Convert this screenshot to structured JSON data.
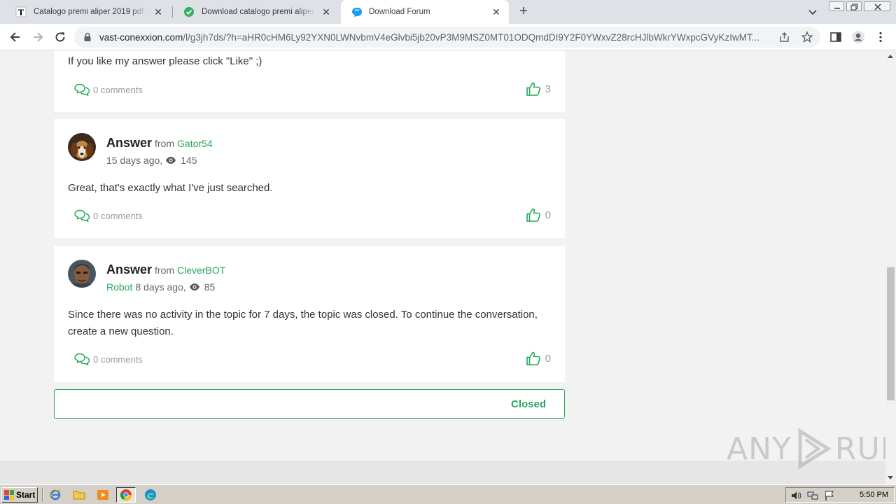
{
  "browser": {
    "tabs": [
      {
        "title": "Catalogo premi aliper 2019 pdf – Tele",
        "icon": "telegraph-t-icon"
      },
      {
        "title": "Download catalogo premi aliper 2019",
        "icon": "green-check-icon"
      },
      {
        "title": "Download Forum",
        "icon": "forum-chat-icon",
        "active": true
      }
    ],
    "url_host": "vast-conexxion.com",
    "url_path": "/l/g3jh7ds/?h=aHR0cHM6Ly92YXN0LWNvbmV4eGlvbi5jb20vP3M9MSZ0MT01ODQmdDI9Y2F0YWxvZ28rcHJlbWkrYWxpcGVyKzIwMT..."
  },
  "posts": {
    "top_fragment": {
      "text": "If you like my answer please click \"Like\" ;)",
      "comments": "0 comments",
      "likes": "3"
    },
    "answers": [
      {
        "label": "Answer",
        "from": "from",
        "author": "Gator54",
        "role": "",
        "age": "15 days ago,",
        "views": "145",
        "text": "Great, that's exactly what I've just searched.",
        "comments": "0 comments",
        "likes": "0"
      },
      {
        "label": "Answer",
        "from": "from",
        "author": "CleverBOT",
        "role": "Robot",
        "age": "8 days ago,",
        "views": "85",
        "text": "Since there was no activity in the topic for 7 days, the topic was closed. To continue the conversation, create a new question.",
        "comments": "0 comments",
        "likes": "0"
      }
    ],
    "status": "Closed"
  },
  "watermark": {
    "left": "ANY",
    "right": "RUN"
  },
  "taskbar": {
    "start": "Start",
    "clock": "5:50 PM"
  },
  "colors": {
    "accent": "#27a55a",
    "muted": "#999999"
  }
}
